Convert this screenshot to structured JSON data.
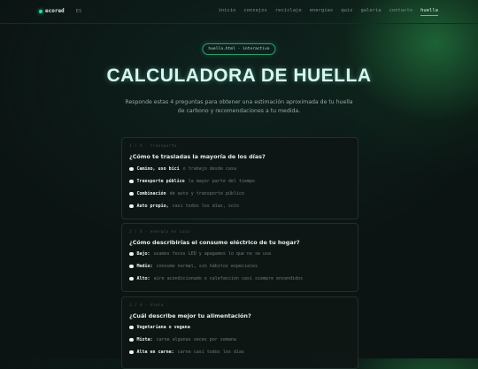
{
  "nav": {
    "brand": "ecored",
    "lang": "ES",
    "links": [
      "inicio",
      "consejos",
      "reciclaje",
      "energías",
      "quiz",
      "galería",
      "contacto",
      "huella"
    ],
    "active": "huella"
  },
  "hero": {
    "pill": "huella.html · interactivo",
    "title": "CALCULADORA DE HUELLA",
    "subtitle": "Responde estas 4 preguntas para obtener una estimación aproximada de tu huella de carbono y recomendaciones a tu medida."
  },
  "questions": [
    {
      "step": "1 / 4 · transporte",
      "question": "¿Cómo te trasladas la mayoría de los días?",
      "options": [
        {
          "label": "Camino, uso bici",
          "desc": "o trabajo desde casa"
        },
        {
          "label": "Transporte público",
          "desc": "la mayor parte del tiempo"
        },
        {
          "label": "Combinación",
          "desc": "de auto y transporte público"
        },
        {
          "label": "Auto propio,",
          "desc": "casi todos los días, solo"
        }
      ]
    },
    {
      "step": "2 / 4 · energía en casa",
      "question": "¿Cómo describirías el consumo eléctrico de tu hogar?",
      "options": [
        {
          "label": "Bajo:",
          "desc": "usamos focos LED y apagamos lo que no se usa"
        },
        {
          "label": "Medio:",
          "desc": "consumo normal, sin hábitos especiales"
        },
        {
          "label": "Alto:",
          "desc": "aire acondicionado o calefacción casi siempre encendidos"
        }
      ]
    },
    {
      "step": "3 / 4 · dieta",
      "question": "¿Cuál describe mejor tu alimentación?",
      "options": [
        {
          "label": "Vegetariana o vegana",
          "desc": ""
        },
        {
          "label": "Mixta:",
          "desc": "carne algunas veces por semana"
        },
        {
          "label": "Alta en carne:",
          "desc": "carne casi todos los días"
        }
      ]
    }
  ],
  "colors": {
    "accent": "#35d39a",
    "background": "#0b1413"
  }
}
